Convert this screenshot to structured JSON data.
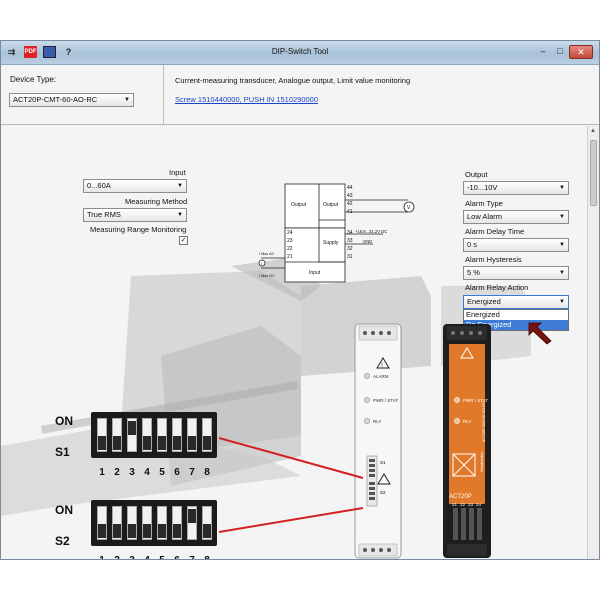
{
  "window": {
    "title": "DIP-Switch Tool",
    "close_glyph": "✕",
    "min_glyph": "–",
    "max_glyph": "□",
    "toolbar_icons": [
      "app-icon",
      "pdf-icon",
      "save-icon",
      "help-icon"
    ],
    "help_label": "?",
    "pdf_label": "PDF"
  },
  "header": {
    "device_type_label": "Device Type:",
    "device_type_value": "ACT20P-CMT-60-AO-RC",
    "description": "Current-measuring transducer, Analogue output, Limit value monitoring",
    "link_text": "Screw 1510440000, PUSH IN 1510290000"
  },
  "left_fields": {
    "input_label": "Input",
    "input_value": "0...60A",
    "method_label": "Measuring Method",
    "method_value": "True RMS",
    "range_monitoring_label": "Measuring Range Monitoring",
    "range_monitoring_checked": true,
    "check_glyph": "✓"
  },
  "right_fields": {
    "output_label": "Output",
    "output_value": "-10...10V",
    "alarm_type_label": "Alarm Type",
    "alarm_type_value": "Low Alarm",
    "alarm_delay_label": "Alarm Delay Time",
    "alarm_delay_value": "0 s",
    "alarm_hysteresis_label": "Alarm Hysteresis",
    "alarm_hysteresis_value": "5 %",
    "relay_action_label": "Alarm Relay Action",
    "relay_action_value": "Energized",
    "relay_action_options": [
      "Energized",
      "De Energized"
    ],
    "relay_action_highlighted": "De Energized"
  },
  "schematic": {
    "output_label": "Output",
    "supply_label": "Supply",
    "input_label": "Input",
    "terminal_numbers_right": [
      "44",
      "43",
      "42",
      "41",
      "34",
      "33",
      "32",
      "31"
    ],
    "terminal_numbers_left": [
      "24",
      "23",
      "22",
      "21"
    ],
    "power_label": "+16.8...31.2V DC",
    "gnd_label": "GND",
    "i_label": "I",
    "v_label": "V",
    "side_labels": [
      "I Max AC",
      "I Max DC"
    ]
  },
  "dip_switches": {
    "on_label": "ON",
    "s1_label": "S1",
    "s2_label": "S2",
    "numbers": [
      "1",
      "2",
      "3",
      "4",
      "5",
      "6",
      "7",
      "8"
    ],
    "s1_positions": [
      "down",
      "down",
      "up",
      "down",
      "down",
      "down",
      "down",
      "down"
    ],
    "s2_positions": [
      "down",
      "down",
      "down",
      "down",
      "down",
      "down",
      "up",
      "down"
    ]
  },
  "device_gray": {
    "alarm_label": "ALARM",
    "pwr_label": "PWR / STAT",
    "rly_label": "RLY",
    "s1_label": "S1",
    "s2_label": "S2"
  },
  "device_orange": {
    "pwr_label": "PWR / STAT",
    "rly_label": "RLY",
    "model_label": "ACT20P",
    "brand_label": "Weidmüller",
    "vertical_label": "ACT20P-CMT-60-AO-RC",
    "terminal_numbers": [
      "21",
      "22",
      "23",
      "24"
    ]
  },
  "colors": {
    "link": "#1a44c8",
    "highlight": "#3d7bd6",
    "wire": "#d42020",
    "device_orange": "#e07a2a",
    "cursor": "#7a1010"
  }
}
